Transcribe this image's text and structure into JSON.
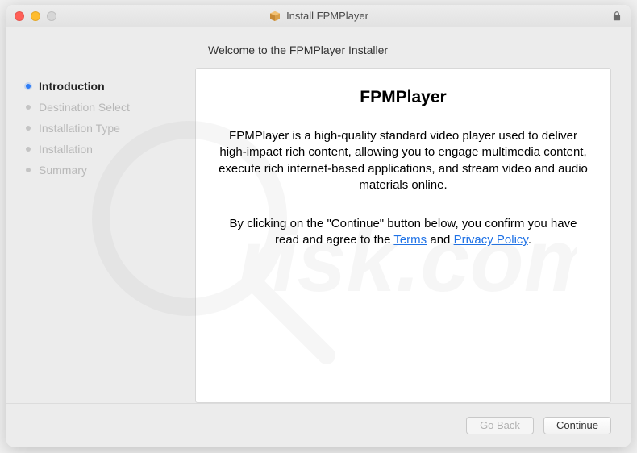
{
  "window": {
    "title": "Install FPMPlayer"
  },
  "header": {
    "welcome": "Welcome to the FPMPlayer Installer"
  },
  "sidebar": {
    "steps": [
      {
        "label": "Introduction",
        "active": true
      },
      {
        "label": "Destination Select",
        "active": false
      },
      {
        "label": "Installation Type",
        "active": false
      },
      {
        "label": "Installation",
        "active": false
      },
      {
        "label": "Summary",
        "active": false
      }
    ]
  },
  "content": {
    "title": "FPMPlayer",
    "description": "FPMPlayer is a high-quality standard video player used to deliver high-impact rich content, allowing you to engage multimedia content, execute rich internet-based applications, and stream video and audio materials online.",
    "agree_prefix": "By clicking on the \"Continue\" button below, you confirm you have read and agree to the ",
    "terms_label": "Terms",
    "and_label": " and ",
    "privacy_label": "Privacy Policy",
    "agree_suffix": "."
  },
  "footer": {
    "go_back_label": "Go Back",
    "continue_label": "Continue"
  },
  "icons": {
    "package": "package-icon",
    "lock": "lock-icon"
  }
}
